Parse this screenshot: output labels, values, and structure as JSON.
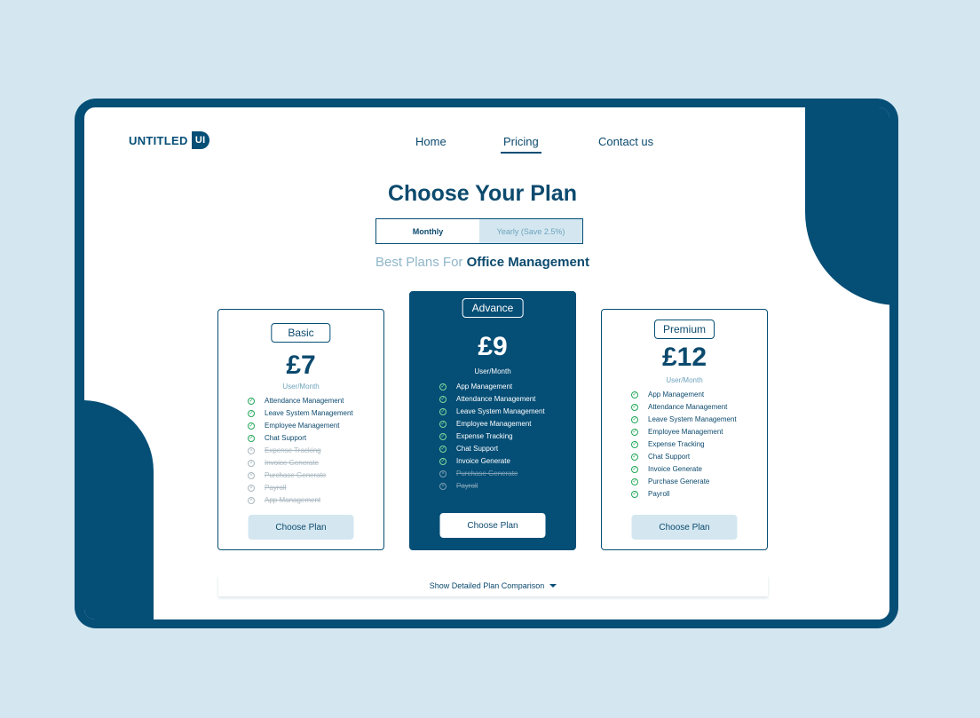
{
  "brand": {
    "name": "UNTITLED",
    "mark": "UI"
  },
  "nav": {
    "home": "Home",
    "pricing": "Pricing",
    "contact": "Contact us"
  },
  "header": {
    "title": "Choose Your Plan"
  },
  "billing": {
    "monthly": "Monthly",
    "yearly": "Yearly (Save 2.5%)"
  },
  "subtitle": {
    "prefix": "Best Plans For ",
    "emphasis": "Office Management"
  },
  "plans": [
    {
      "name": "Basic",
      "price": "£7",
      "period": "User/Month",
      "cta": "Choose Plan",
      "features": [
        {
          "label": "Attendance Management",
          "included": true
        },
        {
          "label": "Leave System Management",
          "included": true
        },
        {
          "label": "Employee Management",
          "included": true
        },
        {
          "label": "Chat Support",
          "included": true
        },
        {
          "label": "Expense Tracking",
          "included": false
        },
        {
          "label": "Invoice Generate",
          "included": false
        },
        {
          "label": "Purchase Generate",
          "included": false
        },
        {
          "label": "Payroll",
          "included": false
        },
        {
          "label": "App Management",
          "included": false
        }
      ]
    },
    {
      "name": "Advance",
      "price": "£9",
      "period": "User/Month",
      "cta": "Choose Plan",
      "features": [
        {
          "label": "App Management",
          "included": true
        },
        {
          "label": "Attendance Management",
          "included": true
        },
        {
          "label": "Leave System Management",
          "included": true
        },
        {
          "label": "Employee Management",
          "included": true
        },
        {
          "label": "Expense Tracking",
          "included": true
        },
        {
          "label": "Chat Support",
          "included": true
        },
        {
          "label": "Invoice Generate",
          "included": true
        },
        {
          "label": "Purchase Generate",
          "included": false
        },
        {
          "label": "Payroll",
          "included": false
        }
      ]
    },
    {
      "name": "Premium",
      "price": "£12",
      "period": "User/Month",
      "cta": "Choose Plan",
      "features": [
        {
          "label": "App Management",
          "included": true
        },
        {
          "label": "Attendance Management",
          "included": true
        },
        {
          "label": "Leave System Management",
          "included": true
        },
        {
          "label": "Employee Management",
          "included": true
        },
        {
          "label": "Expense Tracking",
          "included": true
        },
        {
          "label": "Chat Support",
          "included": true
        },
        {
          "label": "Invoice Generate",
          "included": true
        },
        {
          "label": "Purchase Generate",
          "included": true
        },
        {
          "label": "Payroll",
          "included": true
        }
      ]
    }
  ],
  "compare": {
    "label": "Show Detailed Plan Comparison"
  },
  "icons": {
    "included": "check-circle-icon",
    "excluded": "x-circle-icon",
    "compare": "caret-down-icon"
  },
  "colors": {
    "primary": "#054e76",
    "background": "#d4e7f0",
    "included": "#22a85a",
    "excluded": "#a9b8c0"
  }
}
